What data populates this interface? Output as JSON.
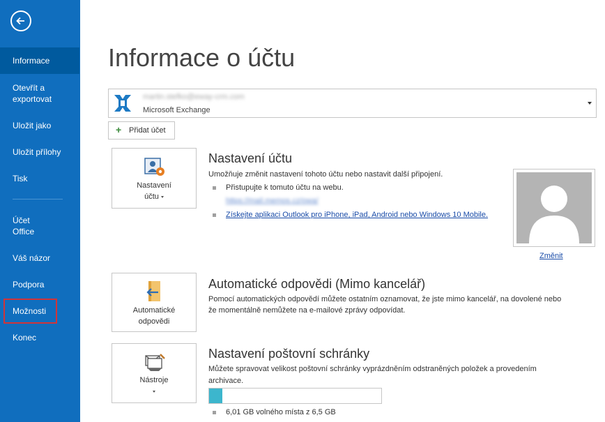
{
  "sidebar": {
    "items": [
      {
        "label": "Informace"
      },
      {
        "label": "Otevřít a exportovat"
      },
      {
        "label": "Uložit jako"
      },
      {
        "label": "Uložit přílohy"
      },
      {
        "label": "Tisk"
      },
      {
        "label": "Účet Office"
      },
      {
        "label": "Váš názor"
      },
      {
        "label": "Podpora"
      },
      {
        "label": "Možnosti"
      },
      {
        "label": "Konec"
      }
    ],
    "active_index": 0,
    "highlighted_index": 8,
    "accent_color": "#106ebe",
    "highlight_color": "#d13438"
  },
  "main": {
    "title": "Informace o účtu",
    "account": {
      "email": "martin.stefko@eway-crm.com",
      "type": "Microsoft Exchange"
    },
    "add_account_label": "Přidat účet",
    "account_settings": {
      "button_line1": "Nastavení",
      "button_line2": "účtu",
      "heading": "Nastavení účtu",
      "description": "Umožňuje změnit nastavení tohoto účtu nebo nastavit další připojení.",
      "bullet1": "Přistupujte k tomuto účtu na webu.",
      "web_link": "https://mail.memos.cz/owa/",
      "app_link": "Získejte aplikaci Outlook pro iPhone, iPad, Android nebo Windows 10 Mobile.",
      "change_photo": "Změnit"
    },
    "auto_replies": {
      "button_line1": "Automatické",
      "button_line2": "odpovědi",
      "heading": "Automatické odpovědi (Mimo kancelář)",
      "line1": "Pomocí automatických odpovědí můžete ostatním oznamovat, že jste mimo kancelář, na dovolené nebo",
      "line2": "že momentálně nemůžete na e-mailové zprávy odpovídat."
    },
    "mailbox": {
      "button_label": "Nástroje",
      "heading": "Nastavení poštovní schránky",
      "line1": "Můžete spravovat velikost poštovní schránky vyprázdněním odstraněných položek a provedením",
      "line2": "archivace.",
      "usage_fraction": 0.075,
      "free_space": "6,01 GB volného místa z 6,5 GB"
    }
  }
}
